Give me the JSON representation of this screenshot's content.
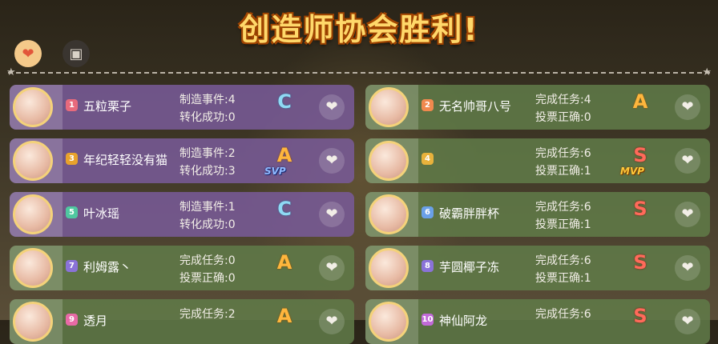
{
  "title": "创造师协会胜利!",
  "top_buttons": {
    "like_icon": "heart-plus-icon",
    "card_icon": "card-add-icon"
  },
  "left_players": [
    {
      "rank": "1",
      "rank_color": "#e86a7c",
      "name": "五粒栗子",
      "stat1": "制造事件:4",
      "stat2": "转化成功:0",
      "grade": "C",
      "badge": "",
      "theme": "purple"
    },
    {
      "rank": "3",
      "rank_color": "#e8a22c",
      "name": "年纪轻轻没有猫",
      "stat1": "制造事件:2",
      "stat2": "转化成功:3",
      "grade": "A",
      "badge": "SVP",
      "theme": "purple"
    },
    {
      "rank": "5",
      "rank_color": "#4fc7a0",
      "name": "叶冰瑶",
      "stat1": "制造事件:1",
      "stat2": "转化成功:0",
      "grade": "C",
      "badge": "",
      "theme": "purple"
    },
    {
      "rank": "7",
      "rank_color": "#8a72d8",
      "name": "利姆露丶",
      "stat1": "完成任务:0",
      "stat2": "投票正确:0",
      "grade": "A",
      "badge": "",
      "theme": "green"
    },
    {
      "rank": "9",
      "rank_color": "#e86aa6",
      "name": "透月",
      "stat1": "完成任务:2",
      "stat2": "",
      "grade": "A",
      "badge": "",
      "theme": "green"
    }
  ],
  "right_players": [
    {
      "rank": "2",
      "rank_color": "#f0894e",
      "name": "无名帅哥八号",
      "stat1": "完成任务:4",
      "stat2": "投票正确:0",
      "grade": "A",
      "badge": "",
      "theme": "green"
    },
    {
      "rank": "4",
      "rank_color": "#e8b23c",
      "name": "",
      "stat1": "完成任务:6",
      "stat2": "投票正确:1",
      "grade": "S",
      "badge": "MVP",
      "theme": "green"
    },
    {
      "rank": "6",
      "rank_color": "#6aa0e8",
      "name": "破霸胖胖杯",
      "stat1": "完成任务:6",
      "stat2": "投票正确:1",
      "grade": "S",
      "badge": "",
      "theme": "green"
    },
    {
      "rank": "8",
      "rank_color": "#8a72d8",
      "name": "芋圆椰子冻",
      "stat1": "完成任务:6",
      "stat2": "投票正确:1",
      "grade": "S",
      "badge": "",
      "theme": "green"
    },
    {
      "rank": "10",
      "rank_color": "#c26ad8",
      "name": "神仙阿龙",
      "stat1": "完成任务:6",
      "stat2": "",
      "grade": "S",
      "badge": "",
      "theme": "green"
    }
  ]
}
